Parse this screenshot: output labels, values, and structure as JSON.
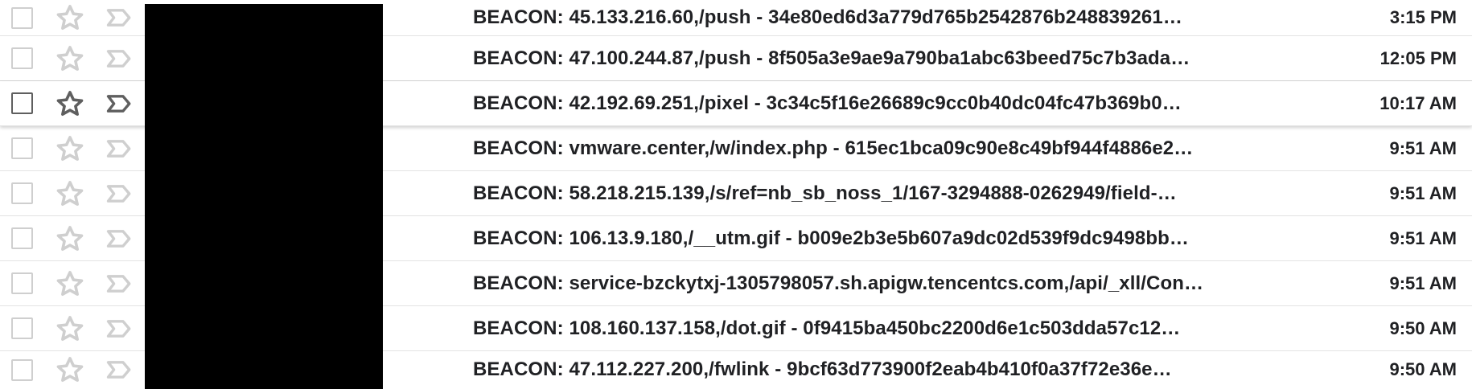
{
  "colors": {
    "redaction": "#000000",
    "icon_idle": "#cfcfcf",
    "icon_hover": "#5f5f5f",
    "text": "#202124",
    "divider": "#e3e3e3"
  },
  "messages": [
    {
      "subject": "BEACON: 45.133.216.60,/push - 34e80ed6d3a779d765b2542876b248839261…",
      "time": "3:15 PM"
    },
    {
      "subject": "BEACON: 47.100.244.87,/push - 8f505a3e9ae9a790ba1abc63beed75c7b3ada…",
      "time": "12:05 PM"
    },
    {
      "subject": "BEACON: 42.192.69.251,/pixel - 3c34c5f16e26689c9cc0b40dc04fc47b369b0…",
      "time": "10:17 AM"
    },
    {
      "subject": "BEACON: vmware.center,/w/index.php - 615ec1bca09c90e8c49bf944f4886e2…",
      "time": "9:51 AM"
    },
    {
      "subject": "BEACON: 58.218.215.139,/s/ref=nb_sb_noss_1/167-3294888-0262949/field-…",
      "time": "9:51 AM"
    },
    {
      "subject": "BEACON: 106.13.9.180,/__utm.gif - b009e2b3e5b607a9dc02d539f9dc9498bb…",
      "time": "9:51 AM"
    },
    {
      "subject": "BEACON: service-bzckytxj-1305798057.sh.apigw.tencentcs.com,/api/_xll/Con…",
      "time": "9:51 AM"
    },
    {
      "subject": "BEACON: 108.160.137.158,/dot.gif - 0f9415ba450bc2200d6e1c503dda57c12…",
      "time": "9:50 AM"
    },
    {
      "subject": "BEACON: 47.112.227.200,/fwlink - 9bcf63d773900f2eab4b410f0a37f72e36e…",
      "time": "9:50 AM"
    }
  ]
}
